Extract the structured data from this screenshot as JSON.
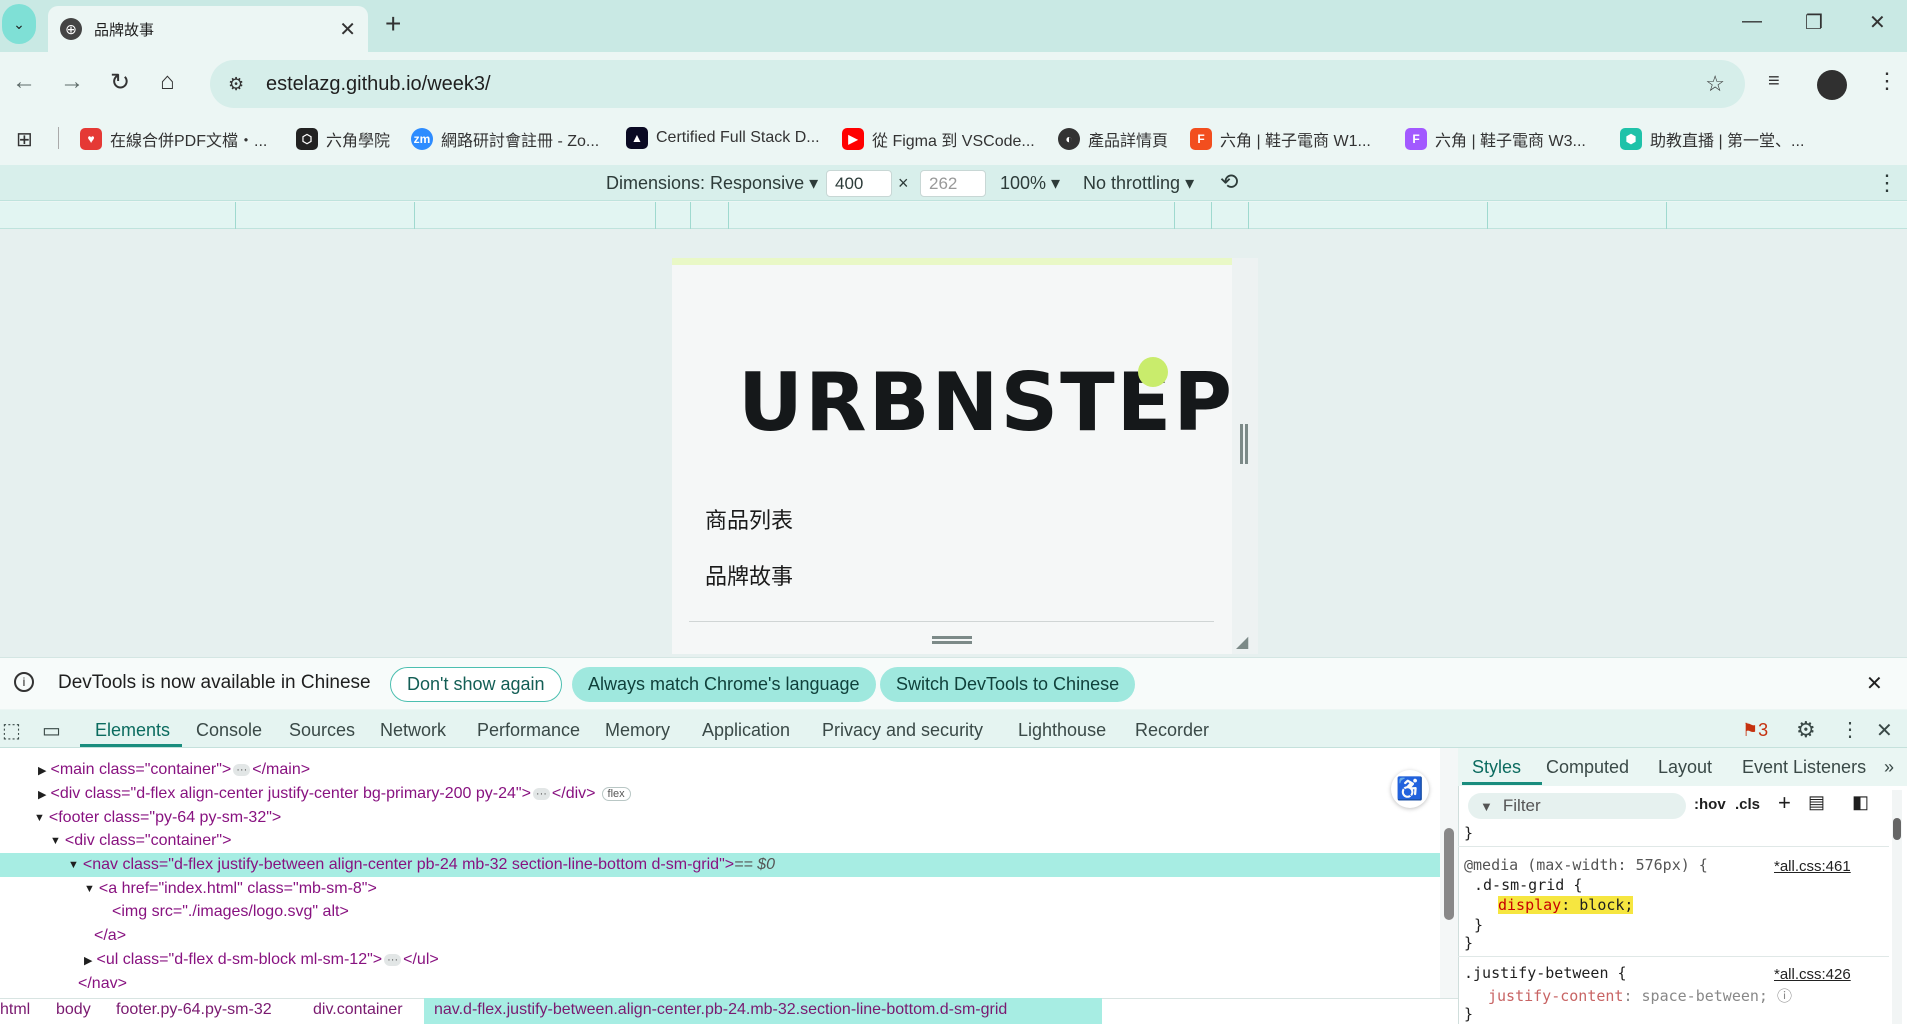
{
  "browser": {
    "tab_title": "品牌故事",
    "url": "estelazg.github.io/week3/",
    "bookmarks": [
      {
        "label": "在線合併PDF文檔・...",
        "icon": "heart-icon",
        "color": "#e53935"
      },
      {
        "label": "六角學院",
        "icon": "hexagon-logo-icon",
        "color": "#222222"
      },
      {
        "label": "網路研討會註冊 - Zo...",
        "icon": "zoom-icon",
        "color": "#2d8cff"
      },
      {
        "label": "Certified Full Stack D...",
        "icon": "freecodecamp-icon",
        "color": "#0a0a23"
      },
      {
        "label": "從 Figma 到 VSCode...",
        "icon": "youtube-icon",
        "color": "#ff0000"
      },
      {
        "label": "產品詳情頁",
        "icon": "globe-icon",
        "color": "#333333"
      },
      {
        "label": "六角 | 鞋子電商 W1...",
        "icon": "figma-icon",
        "color": "#f24e1e"
      },
      {
        "label": "六角 | 鞋子電商 W3...",
        "icon": "figma-icon",
        "color": "#a259ff"
      },
      {
        "label": "助教直播 | 第一堂、...",
        "icon": "hexschool-icon",
        "color": "#1fc2a9"
      }
    ]
  },
  "device_toolbar": {
    "dimensions_label": "Dimensions: Responsive",
    "width": "400",
    "times": "×",
    "height_placeholder": "262",
    "zoom": "100%",
    "throttling": "No throttling"
  },
  "page": {
    "logo_text": "URBNSTEP",
    "nav_items": [
      "商品列表",
      "品牌故事"
    ]
  },
  "infobar": {
    "message": "DevTools is now available in Chinese",
    "dont_show": "Don't show again",
    "always_match": "Always match Chrome's language",
    "switch": "Switch DevTools to Chinese"
  },
  "devtools": {
    "tabs": [
      "Elements",
      "Console",
      "Sources",
      "Network",
      "Performance",
      "Memory",
      "Application",
      "Privacy and security",
      "Lighthouse",
      "Recorder"
    ],
    "issues_count": "3",
    "dom": {
      "main_open": "<main class=\"container\">",
      "main_close": "</main>",
      "div_banner": "<div class=\"d-flex align-center justify-center bg-primary-200 py-24\">",
      "div_close": "</div>",
      "flex_badge": "flex",
      "footer": "<footer class=\"py-64 py-sm-32\">",
      "container": "<div class=\"container\">",
      "nav": "<nav class=\"d-flex justify-between align-center pb-24 mb-32 section-line-bottom d-sm-grid\">",
      "nav_suffix": " == $0",
      "a_open": "<a href=\"index.html\" class=\"mb-sm-8\">",
      "img": "<img src=\"./images/logo.svg\" alt>",
      "a_close": "</a>",
      "ul": "<ul class=\"d-flex d-sm-block ml-sm-12\">",
      "ul_close": "</ul>",
      "nav_close": "</nav>"
    },
    "breadcrumbs": [
      "html",
      "body",
      "footer.py-64.py-sm-32",
      "div.container",
      "nav.d-flex.justify-between.align-center.pb-24.mb-32.section-line-bottom.d-sm-grid"
    ],
    "styles_tabs": [
      "Styles",
      "Computed",
      "Layout",
      "Event Listeners"
    ],
    "filter_placeholder": "Filter",
    "hov": ":hov",
    "cls": ".cls",
    "rules": {
      "media": "@media (max-width: 576px) {",
      "media_source": "*all.css:461",
      "selector1": ".d-sm-grid {",
      "prop1": "display",
      "value1": "block;",
      "selector2": ".justify-between {",
      "selector2_source": "*all.css:426",
      "prop2": "justify-content",
      "value2": "space-between;"
    }
  }
}
